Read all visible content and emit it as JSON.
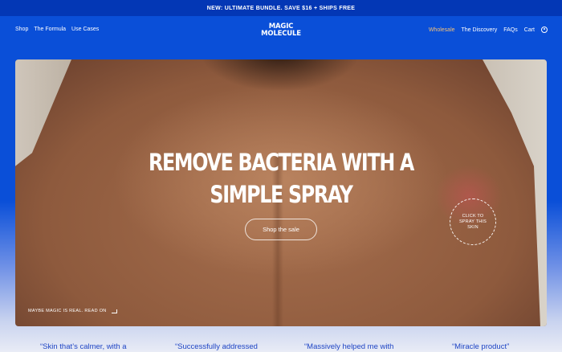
{
  "announcement": "NEW: ULTIMATE BUNDLE. SAVE $16 + SHIPS FREE",
  "logo": {
    "line1": "MAGIC",
    "line2": "MOLECULE"
  },
  "nav_left": [
    "Shop",
    "The Formula",
    "Use Cases"
  ],
  "nav_right": [
    "Wholesale",
    "The Discovery",
    "FAQs",
    "Cart"
  ],
  "account_icon": "account-circle-icon",
  "hero": {
    "headline_line1": "REMOVE BACTERIA WITH A",
    "headline_line2": "SIMPLE SPRAY",
    "cta": "Shop the sale",
    "spray_hint": "CLICK TO SPRAY THIS SKIN",
    "read_on": "MAYBE MAGIC IS REAL. READ ON"
  },
  "testimonials": [
    "“Skin that’s calmer, with a",
    "“Successfully addressed",
    "“Massively helped me with",
    "“Miracle product”"
  ],
  "colors": {
    "brand_blue": "#0a4fd8",
    "announce_blue": "#0337b5",
    "wholesale_accent": "#f2c078",
    "quote_blue": "#1e44c4"
  }
}
